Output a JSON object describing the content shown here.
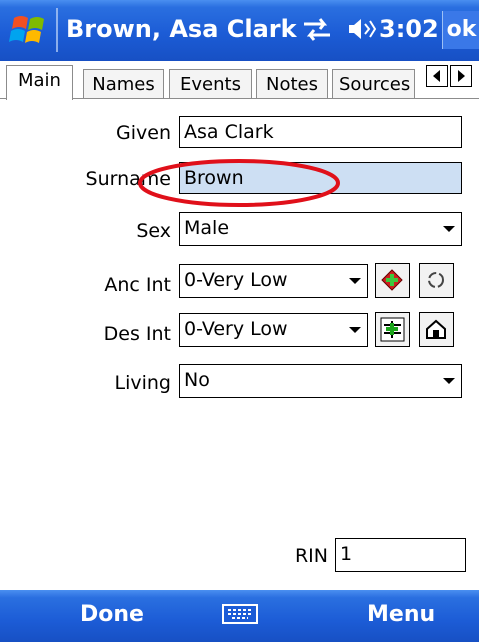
{
  "titlebar": {
    "title": "Brown, Asa Clark",
    "time": "3:02",
    "ok_label": "ok",
    "icons": [
      "windows-flag-icon",
      "connectivity-icon",
      "volume-icon"
    ]
  },
  "tabs": [
    {
      "label": "Main",
      "active": true
    },
    {
      "label": "Names",
      "active": false
    },
    {
      "label": "Events",
      "active": false
    },
    {
      "label": "Notes",
      "active": false
    },
    {
      "label": "Sources",
      "active": false
    }
  ],
  "form": {
    "given": {
      "label": "Given",
      "value": "Asa Clark"
    },
    "surname": {
      "label": "Surname",
      "value": "Brown"
    },
    "sex": {
      "label": "Sex",
      "value": "Male"
    },
    "anc_int": {
      "label": "Anc Int",
      "value": "0-Very Low"
    },
    "des_int": {
      "label": "Des Int",
      "value": "0-Very Low"
    },
    "living": {
      "label": "Living",
      "value": "No"
    },
    "rin": {
      "label": "RIN",
      "value": "1"
    }
  },
  "softkeys": {
    "left": "Done",
    "right": "Menu"
  },
  "colors": {
    "titlebar": "#1c5cd6",
    "selected_field": "#cddff3",
    "annotation": "#e0101a"
  }
}
